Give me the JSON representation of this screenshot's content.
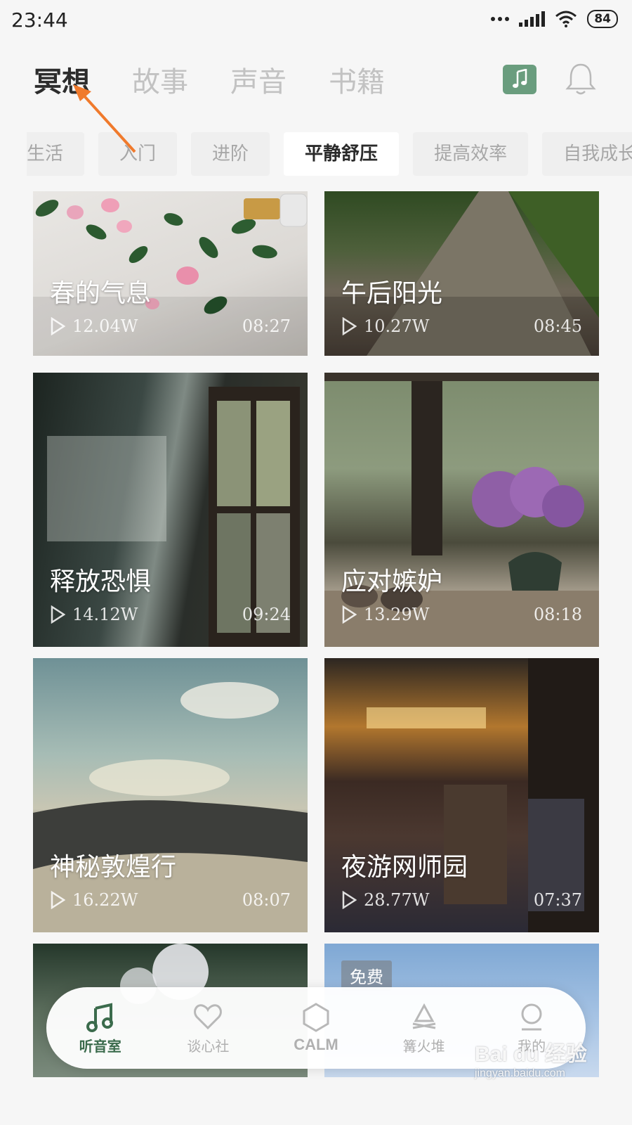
{
  "status_bar": {
    "time": "23:44",
    "battery": "84"
  },
  "top_tabs": [
    {
      "label": "冥想",
      "active": true
    },
    {
      "label": "故事",
      "active": false
    },
    {
      "label": "声音",
      "active": false
    },
    {
      "label": "书籍",
      "active": false
    }
  ],
  "categories": [
    {
      "label": "生活",
      "active": false
    },
    {
      "label": "入门",
      "active": false
    },
    {
      "label": "进阶",
      "active": false
    },
    {
      "label": "平静舒压",
      "active": true
    },
    {
      "label": "提高效率",
      "active": false
    },
    {
      "label": "自我成长",
      "active": false
    }
  ],
  "cards": [
    {
      "title": "春的气息",
      "plays": "12.04W",
      "duration": "08:27"
    },
    {
      "title": "午后阳光",
      "plays": "10.27W",
      "duration": "08:45"
    },
    {
      "title": "释放恐惧",
      "plays": "14.12W",
      "duration": "09:24"
    },
    {
      "title": "应对嫉妒",
      "plays": "13.29W",
      "duration": "08:18"
    },
    {
      "title": "神秘敦煌行",
      "plays": "16.22W",
      "duration": "08:07"
    },
    {
      "title": "夜游网师园",
      "plays": "28.77W",
      "duration": "07:37"
    },
    {
      "badge": ""
    },
    {
      "badge": "免费"
    }
  ],
  "bottom_nav": [
    {
      "label": "听音室",
      "icon": "music-note-icon",
      "active": true
    },
    {
      "label": "谈心社",
      "icon": "heart-icon",
      "active": false
    },
    {
      "label": "CALM",
      "icon": "hexagon-icon",
      "active": false
    },
    {
      "label": "篝火堆",
      "icon": "campfire-icon",
      "active": false
    },
    {
      "label": "我的",
      "icon": "person-icon",
      "active": false
    }
  ],
  "watermark": {
    "line1": "Bai du 经验",
    "line2": "jingyan.baidu.com"
  },
  "colors": {
    "accent": "#3b6b4c",
    "arrow": "#f07a2c"
  }
}
